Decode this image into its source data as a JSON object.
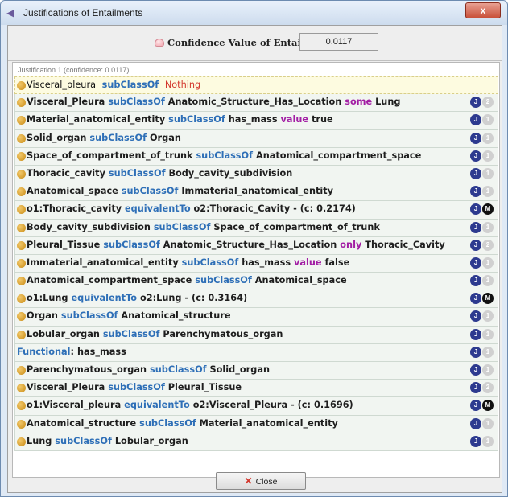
{
  "window": {
    "title": "Justifications of Entailments",
    "close_glyph": "x"
  },
  "confidence": {
    "label": "Confidence Value of Entailment:",
    "value": "0.0117"
  },
  "justification": {
    "header": "Justification 1  (confidence: 0.0117)"
  },
  "root_axiom": {
    "subject": "Visceral_pleura",
    "keyword": "subClassOf",
    "object": "Nothing"
  },
  "axioms": [
    {
      "parts": [
        "Visceral_Pleura",
        " subClassOf ",
        "Anatomic_Structure_Has_Location",
        " some ",
        "Lung"
      ],
      "badge2": "2"
    },
    {
      "parts": [
        "Material_anatomical_entity",
        " subClassOf ",
        "has_mass",
        " value ",
        "true"
      ],
      "badge2": "1"
    },
    {
      "parts": [
        "Solid_organ",
        " subClassOf ",
        "Organ"
      ],
      "badge2": "1"
    },
    {
      "parts": [
        "Space_of_compartment_of_trunk",
        " subClassOf ",
        "Anatomical_compartment_space"
      ],
      "badge2": "1"
    },
    {
      "parts": [
        "Thoracic_cavity",
        " subClassOf ",
        "Body_cavity_subdivision"
      ],
      "badge2": "1"
    },
    {
      "parts": [
        "Anatomical_space",
        " subClassOf ",
        "Immaterial_anatomical_entity"
      ],
      "badge2": "1"
    },
    {
      "parts": [
        "o1:Thoracic_cavity",
        " equivalentTo ",
        "o2:Thoracic_Cavity - (c: 0.2174)"
      ],
      "badge2": "M"
    },
    {
      "parts": [
        "Body_cavity_subdivision",
        " subClassOf ",
        "Space_of_compartment_of_trunk"
      ],
      "badge2": "1"
    },
    {
      "parts": [
        "Pleural_Tissue",
        " subClassOf ",
        "Anatomic_Structure_Has_Location",
        " only ",
        "Thoracic_Cavity"
      ],
      "badge2": "2"
    },
    {
      "parts": [
        "Immaterial_anatomical_entity",
        " subClassOf ",
        "has_mass",
        " value ",
        "false"
      ],
      "badge2": "1"
    },
    {
      "parts": [
        "Anatomical_compartment_space",
        " subClassOf ",
        "Anatomical_space"
      ],
      "badge2": "1"
    },
    {
      "parts": [
        "o1:Lung",
        " equivalentTo ",
        "o2:Lung - (c: 0.3164)"
      ],
      "badge2": "M"
    },
    {
      "parts": [
        "Organ",
        " subClassOf ",
        "Anatomical_structure"
      ],
      "badge2": "1"
    },
    {
      "parts": [
        "Lobular_organ",
        " subClassOf ",
        "Parenchymatous_organ"
      ],
      "badge2": "1"
    },
    {
      "parts": [
        "",
        "Functional",
        ": has_mass"
      ],
      "badge2": "1",
      "no_dot": true
    },
    {
      "parts": [
        "Parenchymatous_organ",
        " subClassOf ",
        "Solid_organ"
      ],
      "badge2": "1"
    },
    {
      "parts": [
        "Visceral_Pleura",
        " subClassOf ",
        "Pleural_Tissue"
      ],
      "badge2": "2"
    },
    {
      "parts": [
        "o1:Visceral_pleura",
        " equivalentTo ",
        "o2:Visceral_Pleura - (c: 0.1696)"
      ],
      "badge2": "M"
    },
    {
      "parts": [
        "Anatomical_structure",
        " subClassOf ",
        "Material_anatomical_entity"
      ],
      "badge2": "1"
    },
    {
      "parts": [
        "Lung",
        " subClassOf ",
        "Lobular_organ"
      ],
      "badge2": "1"
    }
  ],
  "badge_j": "J",
  "footer": {
    "close_label": "Close",
    "close_glyph": "✕"
  },
  "colors": {
    "keyword": "#2e6fb7",
    "restriction": "#a21ea4",
    "nothing": "#d3372d",
    "dot": "#c98b15"
  },
  "icons": [
    "window-icon",
    "confidence-icon",
    "axiom-dot-icon",
    "justification-badge-icon",
    "close-x-icon"
  ]
}
